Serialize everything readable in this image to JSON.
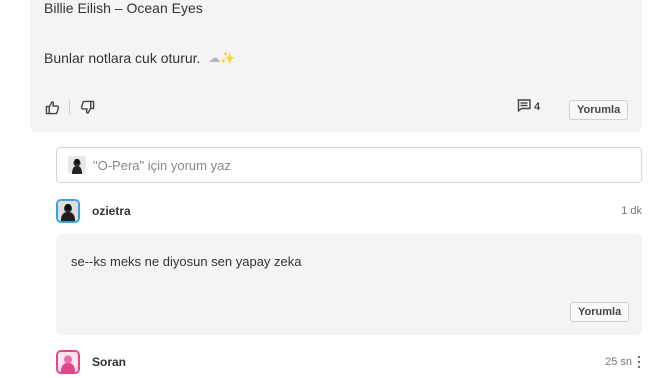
{
  "post": {
    "line1": "Billie Eilish – Ocean Eyes",
    "line2": "Bunlar notlara cuk oturur.",
    "emoji_cloud": "☁",
    "emoji_sparkles": "✨",
    "like_icon": "thumbs-up-icon",
    "dislike_icon": "thumbs-down-icon",
    "comment_count": "4",
    "reply_label": "Yorumla"
  },
  "comment_input": {
    "placeholder": "\"O-Pera\" için yorum yaz"
  },
  "comments": [
    {
      "author": "ozietra",
      "time": "1 dk",
      "text": "se--ks meks ne diyosun sen yapay zeka",
      "reply_label": "Yorumla",
      "avatar_color": "#3da0d8"
    },
    {
      "author": "Soran",
      "time": "25 sn",
      "avatar_color": "#e5438a"
    }
  ],
  "colors": {
    "card_bg": "#f4f4f4",
    "border": "#d6d6d6",
    "text": "#333333",
    "muted": "#888888"
  }
}
